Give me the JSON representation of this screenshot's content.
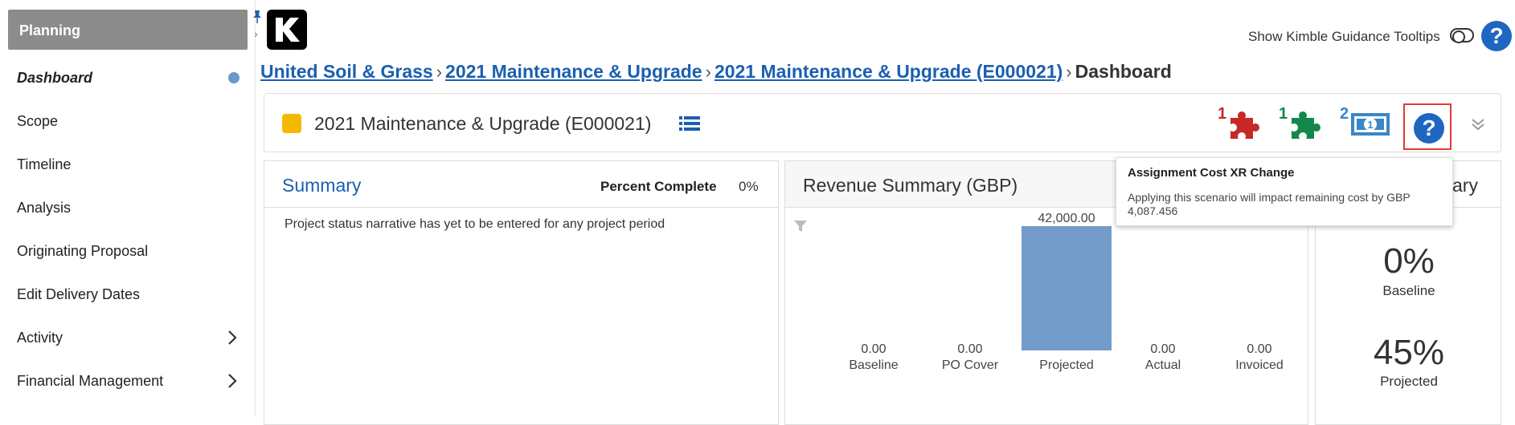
{
  "sidebar": {
    "header": "Planning",
    "items": [
      {
        "label": "Dashboard"
      },
      {
        "label": "Scope"
      },
      {
        "label": "Timeline"
      },
      {
        "label": "Analysis"
      },
      {
        "label": "Originating Proposal"
      },
      {
        "label": "Edit Delivery Dates"
      },
      {
        "label": "Activity"
      },
      {
        "label": "Financial Management"
      }
    ]
  },
  "header": {
    "logo_letter": "K",
    "guidance_label": "Show Kimble Guidance Tooltips",
    "help_glyph": "?"
  },
  "breadcrumb": {
    "items": [
      "United Soil & Grass",
      "2021 Maintenance & Upgrade",
      "2021 Maintenance &  Upgrade (E000021)"
    ],
    "separator": "›",
    "current": "Dashboard"
  },
  "project": {
    "title": "2021 Maintenance & Upgrade (E000021)",
    "status_color": "#f5b800",
    "badges": {
      "red_puzzle_count": "1",
      "green_puzzle_count": "1",
      "money_count": "2"
    },
    "help_glyph": "?"
  },
  "summary": {
    "title": "Summary",
    "percent_label": "Percent Complete",
    "percent_value": "0%",
    "narrative": "Project status narrative has yet to be entered for any project period"
  },
  "revenue": {
    "title": "Revenue Summary (GBP)"
  },
  "chart_data": {
    "type": "bar",
    "categories": [
      "Baseline",
      "PO Cover",
      "Projected",
      "Actual",
      "Invoiced"
    ],
    "values": [
      0,
      0,
      42000,
      0,
      0
    ],
    "data_labels": [
      "0.00",
      "0.00",
      "42,000.00",
      "0.00",
      "0.00"
    ],
    "ylim": [
      0,
      42000
    ],
    "bar_color": "#729bc9",
    "grid": false
  },
  "metrics": {
    "title_fragment": "ary",
    "items": [
      {
        "value": "0%",
        "label": "Baseline"
      },
      {
        "value": "45%",
        "label": "Projected"
      }
    ]
  },
  "tooltip": {
    "title": "Assignment Cost XR Change",
    "text": "Applying this scenario will impact remaining cost by GBP 4,087.456"
  },
  "colors": {
    "link": "#1b5fb0",
    "accent_red": "#c62828",
    "accent_green": "#13884a",
    "accent_blue": "#3a86c8"
  }
}
